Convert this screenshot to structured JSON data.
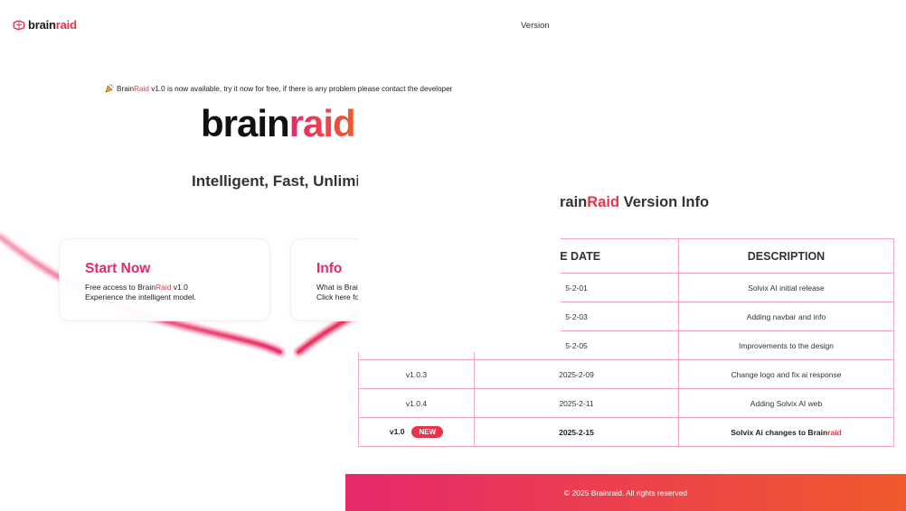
{
  "navbar": {
    "logo_part1": "brain",
    "logo_part2": "raid",
    "version_link": "Version"
  },
  "hero": {
    "announcement_brand1": "Brain",
    "announcement_brand2": "Raid",
    "announcement_text": " v1.0 is now available, try it now for free, if there is any problem please contact the developer",
    "title_part1": "brain",
    "title_part2": "raid",
    "tagline": "Intelligent, Fast, Unlimited"
  },
  "cards": {
    "start": {
      "title": "Start Now",
      "line1_prefix": "Free access to Brain",
      "line1_accent": "Raid",
      "line1_suffix": " v1.0",
      "line2": "Experience the intelligent model."
    },
    "info": {
      "title": "Info",
      "line1": "What is BrainRaid for?",
      "line2": "Click here for more info"
    }
  },
  "version_info": {
    "title_part1": "rain",
    "title_part2": "Raid",
    "title_part3": " Version Info",
    "headers": [
      "",
      "SE DATE",
      "DESCRIPTION"
    ],
    "rows": [
      {
        "version": "",
        "date": "5-2-01",
        "description": "Solvix AI initial release"
      },
      {
        "version": "",
        "date": "5-2-03",
        "description": "Adding navbar and info"
      },
      {
        "version": "",
        "date": "5-2-05",
        "description": "Improvements to the design"
      },
      {
        "version": "v1.0.3",
        "date": "2025-2-09",
        "description": "Change logo and fix ai response"
      },
      {
        "version": "v1.0.4",
        "date": "2025-2-11",
        "description": "Adding Solvix AI web"
      }
    ],
    "latest": {
      "version": "v1.0",
      "badge": "NEW",
      "date": "2025-2-15",
      "description_prefix": "Solvix Ai changes to Brain",
      "description_accent": "raid"
    }
  },
  "footer": {
    "copyright": "© 2025 Brainraid. All rights reserved"
  },
  "colors": {
    "accent": "#e8334a",
    "gradient_start": "#e8286c",
    "gradient_end": "#ef5a2c",
    "table_border": "#f2a6b8"
  }
}
